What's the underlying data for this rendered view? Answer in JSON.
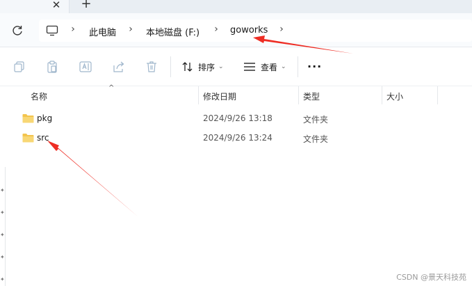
{
  "tabs": {
    "close_glyph": "✕",
    "new_tab_glyph": "+"
  },
  "address_bar": {
    "root_icon": "this-pc-icon",
    "separator": "›",
    "breadcrumbs": [
      "此电脑",
      "本地磁盘 (F:)",
      "goworks"
    ]
  },
  "toolbar": {
    "sort_label": "排序",
    "view_label": "查看",
    "more_label": "···"
  },
  "columns": [
    "名称",
    "修改日期",
    "类型",
    "大小"
  ],
  "rows": [
    {
      "name": "pkg",
      "modified": "2024/9/26 13:18",
      "type": "文件夹",
      "size": ""
    },
    {
      "name": "src",
      "modified": "2024/9/26 13:24",
      "type": "文件夹",
      "size": ""
    }
  ],
  "colors": {
    "folder": "#f3c44d",
    "arrow": "#ee2d24"
  },
  "watermark": "CSDN @景天科技苑"
}
